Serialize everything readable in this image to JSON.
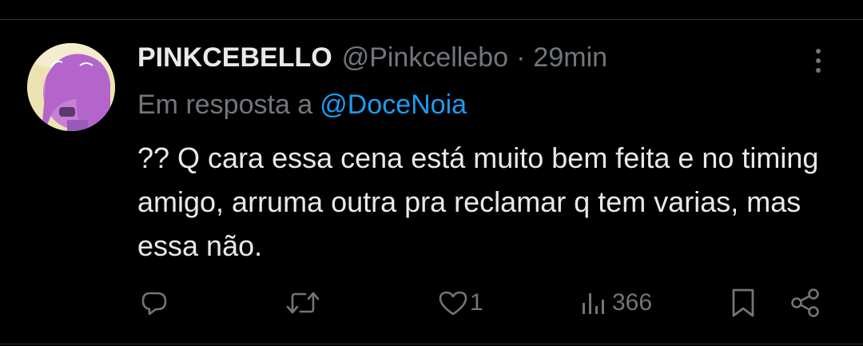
{
  "tweet": {
    "display_name": "PINKCEBELLO",
    "handle": "@Pinkcellebo",
    "separator": "·",
    "time": "29min",
    "reply_prefix": "Em resposta a",
    "reply_mention": "@DoceNoia",
    "text": "?? Q cara essa cena está muito bem feita e no timing amigo, arruma outra pra reclamar q tem varias, mas essa não."
  },
  "actions": {
    "reply_count": "",
    "retweet_count": "",
    "like_count": "1",
    "views_count": "366"
  },
  "colors": {
    "background": "#000000",
    "text_primary": "#e7e9ea",
    "text_secondary": "#71767b",
    "link": "#1d9bf0",
    "divider": "#2f3336"
  },
  "icons": {
    "more": "more-vertical-icon",
    "reply": "reply-icon",
    "retweet": "retweet-icon",
    "like": "heart-icon",
    "views": "views-chart-icon",
    "bookmark": "bookmark-icon",
    "share": "share-icon"
  }
}
